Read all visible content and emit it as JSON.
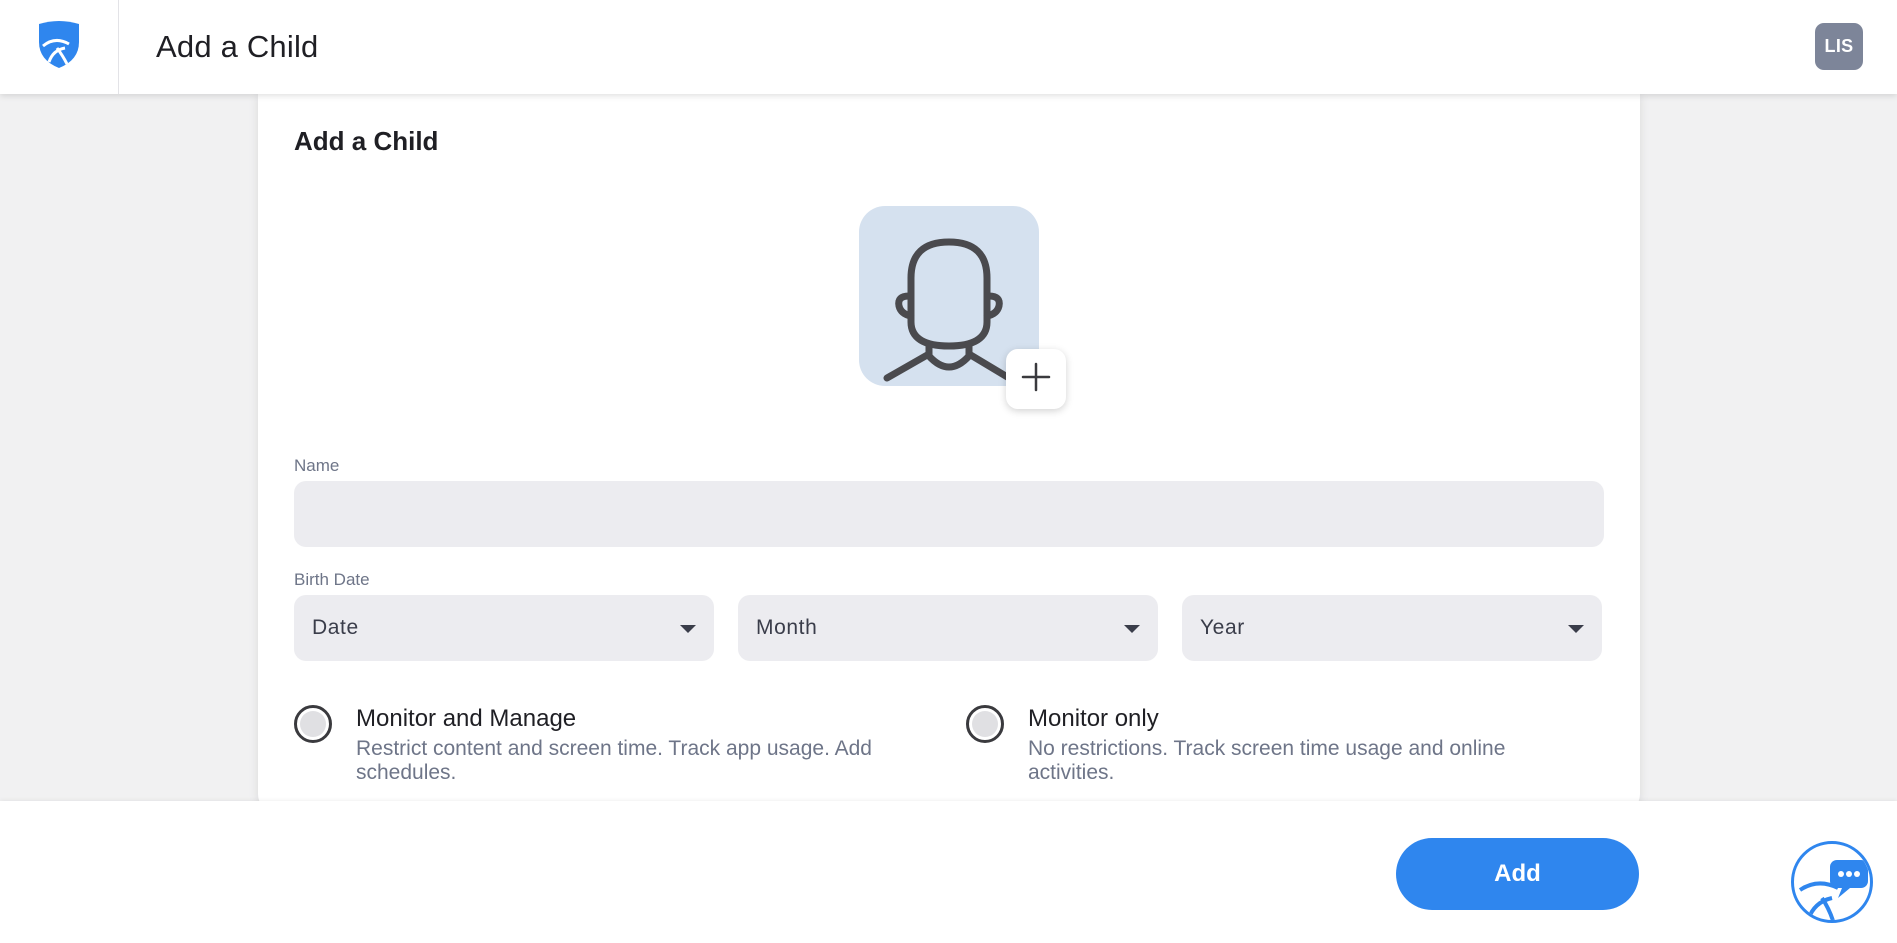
{
  "header": {
    "title": "Add a Child",
    "user_initials": "LIS"
  },
  "card": {
    "title": "Add a Child"
  },
  "form": {
    "name_label": "Name",
    "name_value": "",
    "birth_date_label": "Birth Date",
    "date_placeholder": "Date",
    "month_placeholder": "Month",
    "year_placeholder": "Year"
  },
  "options": [
    {
      "title": "Monitor and Manage",
      "description_line1": "Restrict content and screen time. Track app usage. Add",
      "description_line2": "schedules."
    },
    {
      "title": "Monitor only",
      "description_line1": "No restrictions. Track screen time usage and online",
      "description_line2": "activities."
    }
  ],
  "footer": {
    "add_label": "Add"
  },
  "colors": {
    "accent": "#2f86ee",
    "avatar_bg": "#d5e1ef",
    "input_bg": "#ececf0",
    "badge_bg": "#7d8599"
  }
}
